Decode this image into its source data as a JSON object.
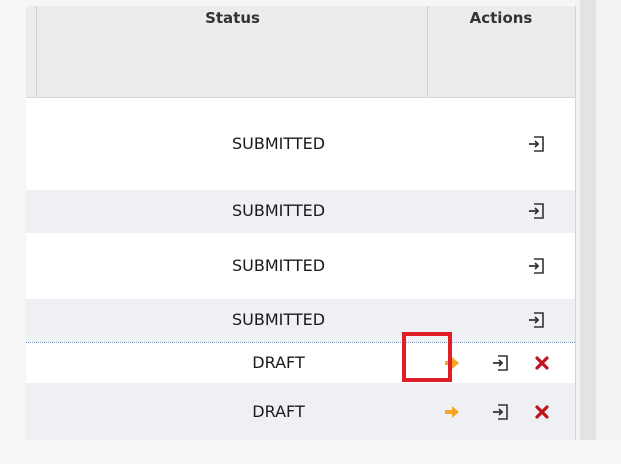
{
  "table": {
    "columns": {
      "status": "Status",
      "actions": "Actions"
    },
    "rows": [
      {
        "status": "SUBMITTED",
        "actions": [
          "open"
        ]
      },
      {
        "status": "SUBMITTED",
        "actions": [
          "open"
        ]
      },
      {
        "status": "SUBMITTED",
        "actions": [
          "open"
        ]
      },
      {
        "status": "SUBMITTED",
        "actions": [
          "open"
        ]
      },
      {
        "status": "DRAFT",
        "actions": [
          "submit",
          "open",
          "delete"
        ]
      },
      {
        "status": "DRAFT",
        "actions": [
          "submit",
          "open",
          "delete"
        ]
      }
    ]
  },
  "icons": {
    "open": "open-document-icon",
    "submit": "arrow-right-icon",
    "delete": "delete-x-icon"
  },
  "colors": {
    "submit_arrow": "#f5a623",
    "delete_x": "#c0131b",
    "highlight_box": "#e01e25"
  }
}
